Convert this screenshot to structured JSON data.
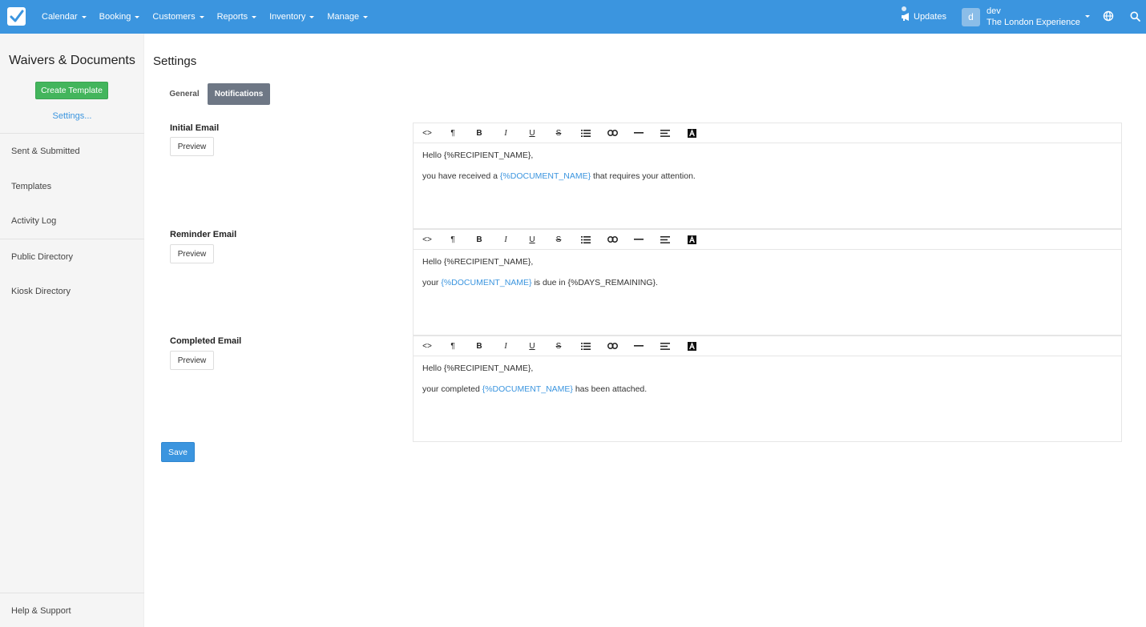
{
  "colors": {
    "nav": "#3b95df",
    "primary": "#3b95df",
    "success": "#43b55c",
    "tab_active": "#6e7785"
  },
  "topnav": {
    "menu": [
      {
        "label": "Calendar"
      },
      {
        "label": "Booking"
      },
      {
        "label": "Customers"
      },
      {
        "label": "Reports"
      },
      {
        "label": "Inventory"
      },
      {
        "label": "Manage"
      }
    ],
    "updates_label": "Updates",
    "avatar_letter": "d",
    "user_name": "dev",
    "company": "The London Experience",
    "icons": [
      "checkbox-logo-icon",
      "megaphone-icon",
      "globe-icon",
      "search-icon"
    ]
  },
  "sidebar": {
    "title": "Waivers & Documents",
    "create_label": "Create Template",
    "settings_label": "Settings...",
    "items": [
      {
        "label": "Sent & Submitted"
      },
      {
        "label": "Templates"
      },
      {
        "label": "Activity Log"
      },
      {
        "label": "Public Directory"
      },
      {
        "label": "Kiosk Directory"
      }
    ],
    "help_label": "Help & Support"
  },
  "main": {
    "title": "Settings",
    "tabs": [
      {
        "label": "General",
        "active": false
      },
      {
        "label": "Notifications",
        "active": true
      }
    ],
    "preview_label": "Preview",
    "save_label": "Save",
    "toolbar_icons": [
      "code-icon",
      "paragraph-icon",
      "bold-icon",
      "italic-icon",
      "underline-icon",
      "strikethrough-icon",
      "list-icon",
      "link-icon",
      "horizontal-rule-icon",
      "align-icon",
      "text-color-icon"
    ],
    "toolbar_glyphs": {
      "code": "<>",
      "paragraph": "¶",
      "bold": "B",
      "italic": "I",
      "underline": "U",
      "strike": "S"
    },
    "emails": [
      {
        "label": "Initial Email",
        "line1": "Hello {%RECIPIENT_NAME},",
        "line2_before": "you have received a ",
        "line2_var": "{%DOCUMENT_NAME}",
        "line2_after": " that requires your attention."
      },
      {
        "label": "Reminder Email",
        "line1": "Hello {%RECIPIENT_NAME},",
        "line2_before": "your ",
        "line2_var": "{%DOCUMENT_NAME}",
        "line2_after": " is due in {%DAYS_REMAINING}."
      },
      {
        "label": "Completed Email",
        "line1": "Hello {%RECIPIENT_NAME},",
        "line2_before": "your completed ",
        "line2_var": "{%DOCUMENT_NAME}",
        "line2_after": " has been attached."
      }
    ]
  }
}
